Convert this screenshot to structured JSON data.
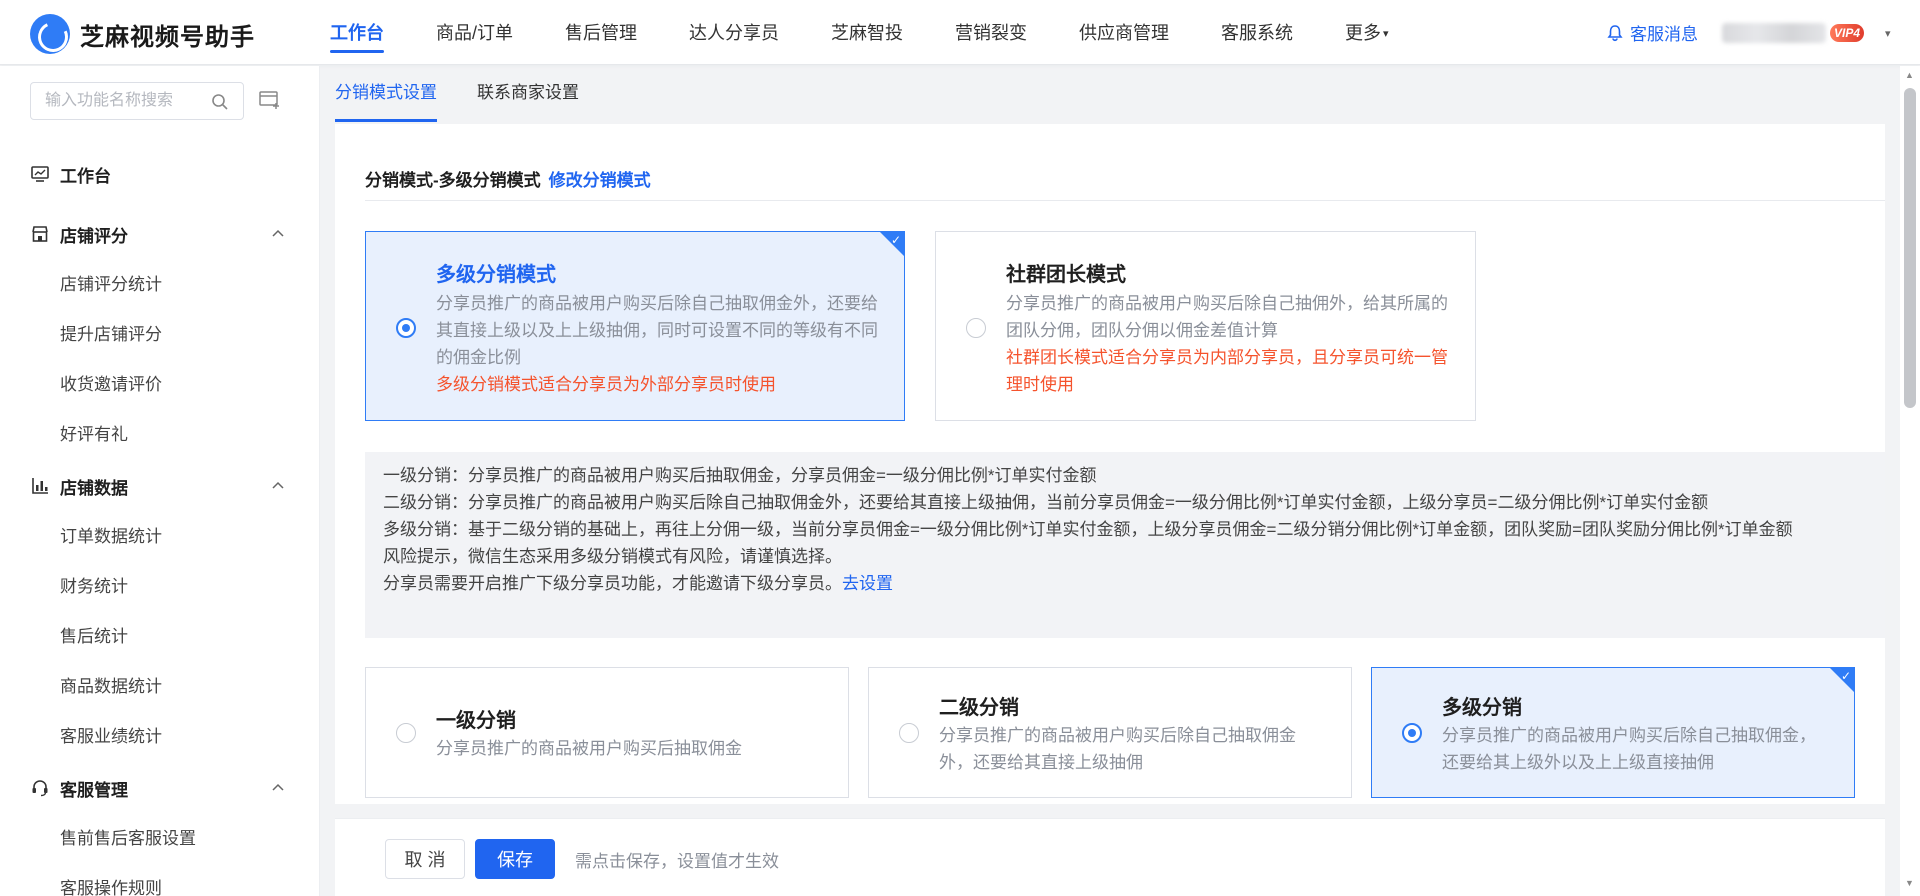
{
  "app": {
    "logo_text": "芝麻视频号助手"
  },
  "topnav": {
    "items": [
      "工作台",
      "商品/订单",
      "售后管理",
      "达人分享员",
      "芝麻智投",
      "营销裂变",
      "供应商管理",
      "客服系统",
      "更多"
    ],
    "active_index": 0,
    "more_caret": "▾",
    "message_label": "客服消息",
    "vip_badge": "VIP4"
  },
  "sidebar": {
    "search_placeholder": "输入功能名称搜索",
    "workbench": "工作台",
    "groups": [
      {
        "label": "店铺评分",
        "icon": "shop-icon",
        "items": [
          "店铺评分统计",
          "提升店铺评分",
          "收货邀请评价",
          "好评有礼"
        ]
      },
      {
        "label": "店铺数据",
        "icon": "chart-icon",
        "items": [
          "订单数据统计",
          "财务统计",
          "售后统计",
          "商品数据统计",
          "客服业绩统计"
        ]
      },
      {
        "label": "客服管理",
        "icon": "headset-icon",
        "items": [
          "售前售后客服设置",
          "客服操作规则"
        ]
      }
    ]
  },
  "tabs": {
    "items": [
      "分销模式设置",
      "联系商家设置"
    ],
    "active_index": 0
  },
  "panel": {
    "title": "分销模式-多级分销模式",
    "edit_link": "修改分销模式",
    "modes": [
      {
        "title": "多级分销模式",
        "selected": true,
        "desc": "分享员推广的商品被用户购买后除自己抽取佣金外，还要给其直接上级以及上上级抽佣，同时可设置不同的等级有不同的佣金比例",
        "warn": "多级分销模式适合分享员为外部分享员时使用"
      },
      {
        "title": "社群团长模式",
        "selected": false,
        "desc": "分享员推广的商品被用户购买后除自己抽佣外，给其所属的团队分佣，团队分佣以佣金差值计算",
        "warn": "社群团长模式适合分享员为内部分享员，且分享员可统一管理时使用"
      }
    ],
    "info_lines": [
      "一级分销：分享员推广的商品被用户购买后抽取佣金，分享员佣金=一级分佣比例*订单实付金额",
      "二级分销：分享员推广的商品被用户购买后除自己抽取佣金外，还要给其直接上级抽佣，当前分享员佣金=一级分佣比例*订单实付金额，上级分享员=二级分佣比例*订单实付金额",
      "多级分销：基于二级分销的基础上，再往上分佣一级，当前分享员佣金=一级分佣比例*订单实付金额，上级分享员佣金=二级分销分佣比例*订单金额，团队奖励=团队奖励分佣比例*订单金额",
      "风险提示，微信生态采用多级分销模式有风险，请谨慎选择。",
      "分享员需要开启推广下级分享员功能，才能邀请下级分享员。"
    ],
    "info_link": "去设置",
    "levels": [
      {
        "title": "一级分销",
        "selected": false,
        "desc": "分享员推广的商品被用户购买后抽取佣金"
      },
      {
        "title": "二级分销",
        "selected": false,
        "desc": "分享员推广的商品被用户购买后除自己抽取佣金外，还要给其直接上级抽佣"
      },
      {
        "title": "多级分销",
        "selected": true,
        "desc": "分享员推广的商品被用户购买后除自己抽取佣金，还要给其上级外以及上上级直接抽佣"
      }
    ]
  },
  "footer": {
    "cancel": "取 消",
    "save": "保存",
    "hint": "需点击保存，设置值才生效"
  },
  "colors": {
    "primary": "#2065f0",
    "selected_bg": "#e8f0fd",
    "warning": "#f5532d",
    "info_bg": "#f2f3f6"
  }
}
